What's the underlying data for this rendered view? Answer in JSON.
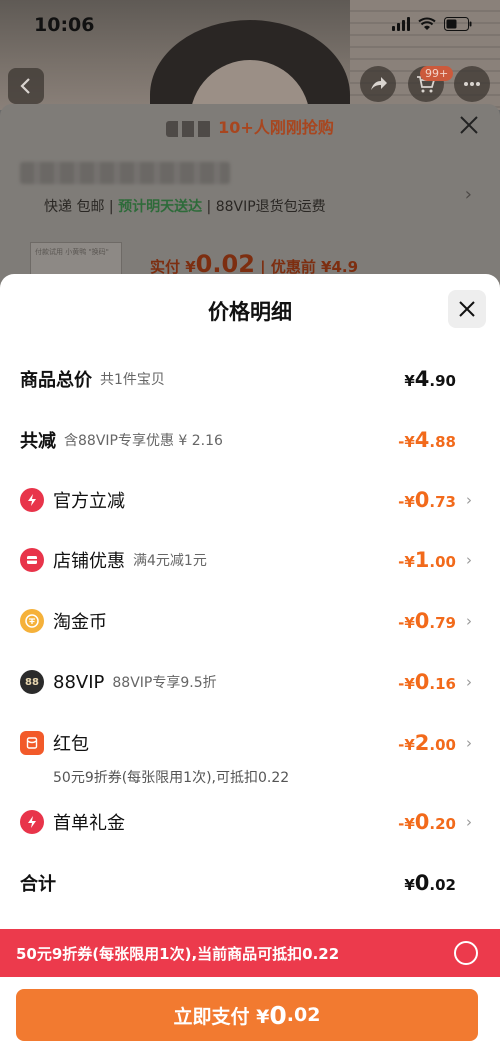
{
  "status": {
    "time": "10:06"
  },
  "nav": {
    "cart_badge": "99+"
  },
  "order": {
    "hot_text": "10+人刚刚抢购",
    "delivery": {
      "express": "快递 包邮",
      "eta": "预计明天送达",
      "vip": "88VIP退货包运费"
    },
    "product_thumb_text": "付款试用 小黄鸭 \"换码\"",
    "pay_label": "实付 ¥",
    "pay_amount": "0.02",
    "before_discount": "| 优惠前 ¥4.9"
  },
  "sheet": {
    "title": "价格明细",
    "total": {
      "label": "商品总价",
      "sub": "共1件宝贝",
      "currency": "¥",
      "amount_big": "4",
      "amount_small": ".90"
    },
    "reduced": {
      "label": "共减",
      "sub": "含88VIP专享优惠 ¥ 2.16",
      "prefix": "-¥",
      "amount_big": "4",
      "amount_small": ".88"
    },
    "items": [
      {
        "label": "官方立减",
        "sub": "",
        "prefix": "-¥",
        "amount_big": "0",
        "amount_small": ".73",
        "icon": "lightning-icon",
        "color": "#e8344a"
      },
      {
        "label": "店铺优惠",
        "sub": "满4元减1元",
        "prefix": "-¥",
        "amount_big": "1",
        "amount_small": ".00",
        "icon": "shop-coupon-icon",
        "color": "#e8344a"
      },
      {
        "label": "淘金币",
        "sub": "",
        "prefix": "-¥",
        "amount_big": "0",
        "amount_small": ".79",
        "icon": "gold-coin-icon",
        "color": "#f5a623"
      },
      {
        "label": "88VIP",
        "sub": "88VIP专享9.5折",
        "prefix": "-¥",
        "amount_big": "0",
        "amount_small": ".16",
        "icon": "88vip-icon",
        "color": "#2b2b2b"
      },
      {
        "label": "红包",
        "sub": "",
        "prefix": "-¥",
        "amount_big": "2",
        "amount_small": ".00",
        "icon": "red-packet-icon",
        "color": "#f25a2a"
      },
      {
        "label": "首单礼金",
        "sub": "",
        "prefix": "-¥",
        "amount_big": "0",
        "amount_small": ".20",
        "icon": "lightning-icon",
        "color": "#e8344a"
      }
    ],
    "red_packet_note": "50元9折券(每张限用1次),可抵扣0.22",
    "sum": {
      "label": "合计",
      "currency": "¥",
      "amount_big": "0",
      "amount_small": ".02"
    },
    "coupon_bar": "50元9折券(每张限用1次),当前商品可抵扣0.22",
    "pay_button": {
      "label": "立即支付 ¥",
      "amount_big": "0",
      "amount_small": ".02"
    }
  },
  "colors": {
    "accent_orange": "#f26a1b",
    "coupon_red": "#ec3a4c",
    "pay_button": "#f27a30"
  }
}
